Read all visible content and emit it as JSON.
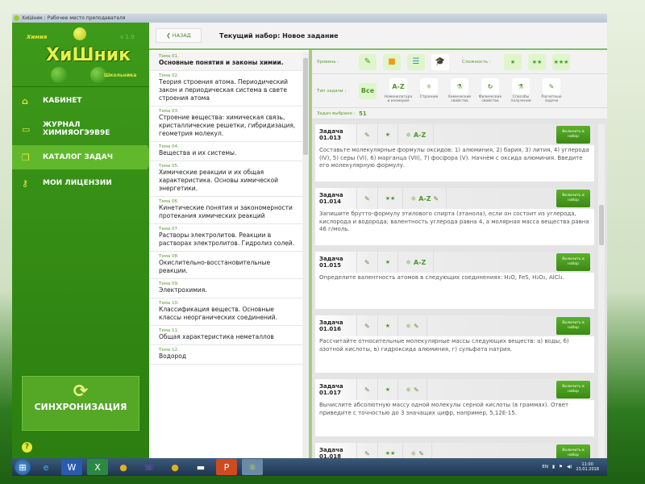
{
  "window": {
    "title": "ХиШник : Рабочее место преподавателя"
  },
  "logo": {
    "top": "Химия",
    "main": "ХиШник",
    "bottom": "Школьника",
    "version": "v 1.9"
  },
  "sidebar": {
    "items": [
      {
        "label": "КАБИНЕТ",
        "icon": "home-icon"
      },
      {
        "label": "ЖУРНАЛ ХИМИЯОГЭ9В9Е",
        "icon": "book-icon"
      },
      {
        "label": "КАТАЛОГ ЗАДАЧ",
        "icon": "catalog-icon",
        "active": true
      },
      {
        "label": "МОИ ЛИЦЕНЗИИ",
        "icon": "key-icon"
      }
    ],
    "sync": "СИНХРОНИЗАЦИЯ",
    "help": "?"
  },
  "header": {
    "back": "НАЗАД",
    "title": "Текущий набор: Новое задание"
  },
  "topics": [
    {
      "n": "Тема 01.",
      "t": "Основные понятия и законы химии."
    },
    {
      "n": "Тема 02.",
      "t": "Теория строения атома. Периодический закон и периодическая система в свете строения атома"
    },
    {
      "n": "Тема 03.",
      "t": "Строение вещества: химическая связь, кристаллические решетки, гибридизация, геометрия молекул."
    },
    {
      "n": "Тема 04.",
      "t": "Вещества и их системы."
    },
    {
      "n": "Тема 05.",
      "t": "Химические реакции и их общая характеристика. Основы химической энергетики."
    },
    {
      "n": "Тема 06.",
      "t": "Кинетические понятия и закономерности протекания химических реакций"
    },
    {
      "n": "Тема 07.",
      "t": "Растворы электролитов. Реакции в растворах электролитов. Гидролиз солей."
    },
    {
      "n": "Тема 08.",
      "t": "Окислительно-восстановительные реакции."
    },
    {
      "n": "Тема 09.",
      "t": "Электрохимия."
    },
    {
      "n": "Тема 10.",
      "t": "Классификация веществ.  Основные классы неорганических соединений."
    },
    {
      "n": "Тема 11.",
      "t": "Общая характеристика неметаллов"
    },
    {
      "n": "Тема 12.",
      "t": "Водород"
    }
  ],
  "filters": {
    "level_label": "Уровень :",
    "complexity_label": "Сложность :",
    "type_label": "Тип задачи :",
    "all": "Все",
    "types": [
      {
        "icon": "A-Z",
        "label": "Номенклатура и изомерия"
      },
      {
        "icon": "⚛",
        "label": "Строение"
      },
      {
        "icon": "⚗",
        "label": "Химические свойства"
      },
      {
        "icon": "↻",
        "label": "Физические свойства"
      },
      {
        "icon": "⚗",
        "label": "Способы получения"
      },
      {
        "icon": "✎",
        "label": "Расчетные задачи"
      }
    ],
    "selected_label": "Задач выбрано :",
    "selected_count": "51"
  },
  "task_word": "Задача",
  "add_label": "Включить в набор",
  "tasks": [
    {
      "num": "01.013",
      "stars": "★",
      "types": "A-Z",
      "text": "Составьте молекулярные формулы оксидов: 1) алюминия, 2) бария, 3) лития, 4) углерода (IV), 5) серы (VI), 6) марганца (VII), 7) фосфора (V). Начнём с оксида алюминия. Введите его молекулярную формулу."
    },
    {
      "num": "01.014",
      "stars": "★★",
      "types": "A-Z ✎",
      "text": "Запишите брутто-формулу этилового спирта (этанола), если он состоит из углерода, кислорода и водорода; валентность углерода равна 4, а молярная масса вещества равна 46 г/моль."
    },
    {
      "num": "01.015",
      "stars": "★",
      "types": "A-Z",
      "text": "Определите валентность атомов в следующих соединениях: H₂O, FeS, H₂O₂, AlCl₃."
    },
    {
      "num": "01.016",
      "stars": "★",
      "types": "✎",
      "text": "Рассчитайте относительные молекулярные массы следующих веществ: а) воды, б) азотной кислоты, в) гидроксида алюминия, г) сульфата натрия."
    },
    {
      "num": "01.017",
      "stars": "★",
      "types": "✎",
      "text": "Вычислите абсолютную массу одной молекулы серной кислоты (в граммах). Ответ приведите с точностью до 3 значащих цифр, например, 5,12E-15."
    },
    {
      "num": "01.018",
      "stars": "★★",
      "types": "✎",
      "text": ""
    }
  ],
  "taskbar": {
    "lang": "EN",
    "time": "11:00",
    "date": "23.01.2018"
  }
}
